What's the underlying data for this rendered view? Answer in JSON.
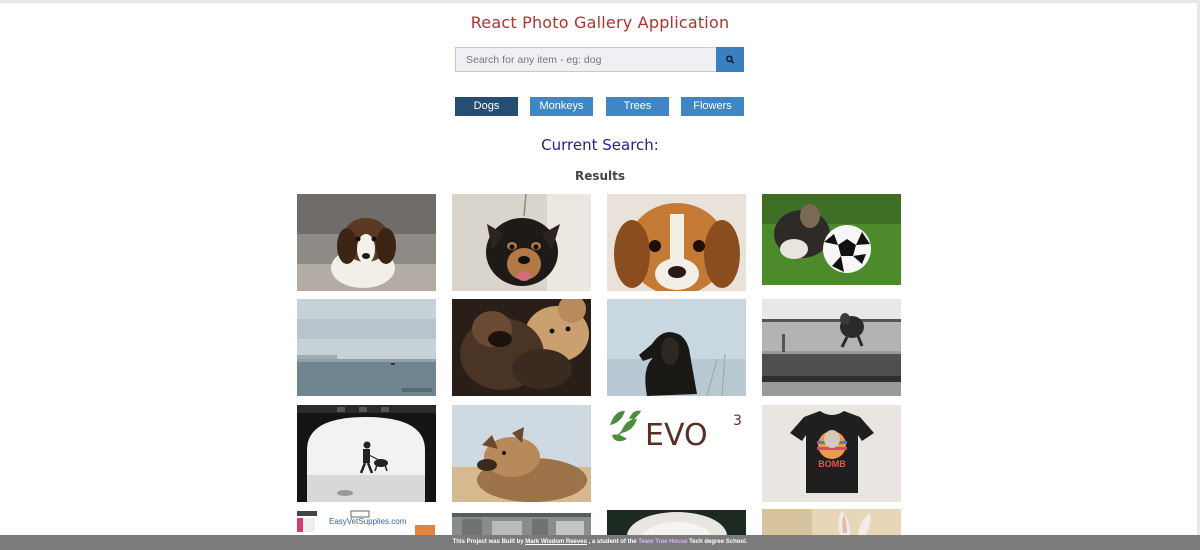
{
  "header": {
    "title": "React Photo Gallery Application"
  },
  "search": {
    "placeholder": "Search for any item - eg: dog",
    "button_icon": "search-icon"
  },
  "categories": [
    {
      "label": "Dogs",
      "active": true
    },
    {
      "label": "Monkeys",
      "active": false
    },
    {
      "label": "Trees",
      "active": false
    },
    {
      "label": "Flowers",
      "active": false
    }
  ],
  "current_search_label": "Current Search:",
  "results_label": "Results",
  "photos": [
    {
      "name": "beagle-puppy-photo"
    },
    {
      "name": "black-tan-dog-photo"
    },
    {
      "name": "beagle-face-photo"
    },
    {
      "name": "dog-with-soccer-ball-photo"
    },
    {
      "name": "sea-horizon-photo"
    },
    {
      "name": "puppies-cuddling-photo"
    },
    {
      "name": "dog-silhouette-sky-photo"
    },
    {
      "name": "dog-running-beach-photo"
    },
    {
      "name": "person-walking-dog-tunnel-photo"
    },
    {
      "name": "dog-lying-sand-photo"
    },
    {
      "name": "evo3-logo-image",
      "text": "EVO",
      "superscript": "3"
    },
    {
      "name": "dog-tshirt-photo",
      "text": "BOMB"
    },
    {
      "name": "easyvetsupplies-ad-image",
      "text": "EasyVetSupplies.com"
    },
    {
      "name": "building-photo"
    },
    {
      "name": "dog-closeup-photo"
    },
    {
      "name": "rabbit-ears-photo"
    }
  ],
  "footer": {
    "prefix": "This Project was Built by ",
    "author": "Mark Wisdom Reeves",
    "middle": " , a student of the ",
    "school": "Team Tree House",
    "suffix": " Tech degree School."
  },
  "colors": {
    "title": "#a8362f",
    "active_button": "#264e73",
    "button": "#3f86c6",
    "current_search": "#2a2085",
    "footer_bg": "#7b7b7b"
  }
}
